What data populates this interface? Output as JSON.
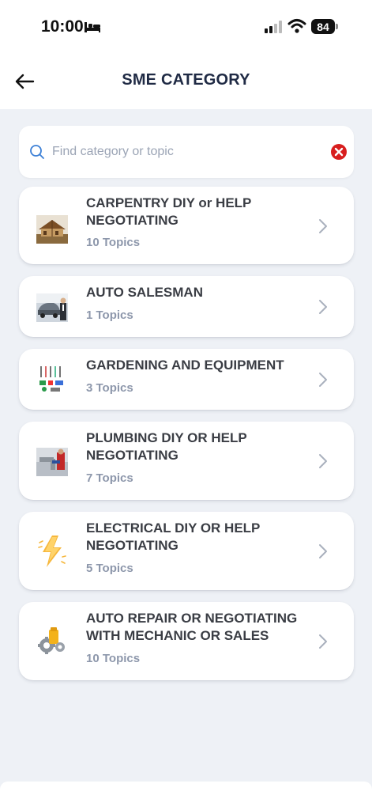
{
  "status": {
    "time": "10:00",
    "battery": "84"
  },
  "header": {
    "title": "SME CATEGORY"
  },
  "search": {
    "placeholder": "Find category or topic",
    "value": ""
  },
  "categories": [
    {
      "title": "CARPENTRY DIY or HELP NEGOTIATING",
      "topics": "10 Topics",
      "icon": "house-construction-icon"
    },
    {
      "title": "AUTO SALESMAN",
      "topics": "1 Topics",
      "icon": "car-salesman-icon"
    },
    {
      "title": "GARDENING AND EQUIPMENT",
      "topics": "3 Topics",
      "icon": "garden-tools-icon"
    },
    {
      "title": "PLUMBING DIY OR HELP NEGOTIATING",
      "topics": "7 Topics",
      "icon": "plumbing-icon"
    },
    {
      "title": "ELECTRICAL DIY OR HELP NEGOTIATING",
      "topics": "5 Topics",
      "icon": "lightning-icon"
    },
    {
      "title": "AUTO REPAIR OR NEGOTIATING WITH MECHANIC OR SALES",
      "topics": "10 Topics",
      "icon": "mechanic-icon"
    }
  ],
  "colors": {
    "background": "#eef1f6",
    "title": "#1f2a44",
    "topics": "#8d97ab",
    "clear": "#d81e1e",
    "search_icon": "#3b7fd6"
  }
}
